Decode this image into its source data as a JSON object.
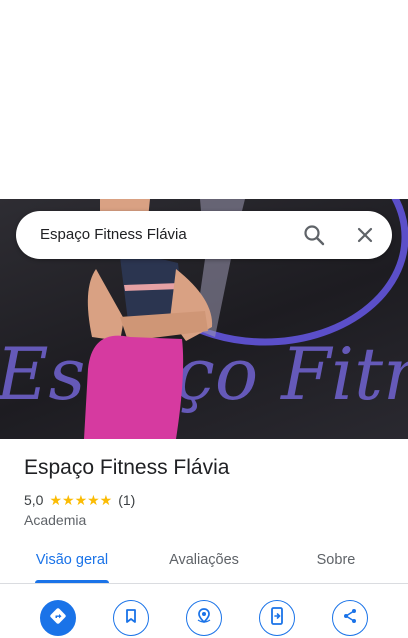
{
  "search": {
    "query": "Espaço Fitness Flávia"
  },
  "hero": {
    "wall_text": "Espaço Fitness"
  },
  "place": {
    "name": "Espaço Fitness Flávia",
    "rating": "5,0",
    "stars": "★★★★★",
    "review_count": "(1)",
    "category": "Academia"
  },
  "tabs": [
    {
      "label": "Visão geral",
      "active": true
    },
    {
      "label": "Avaliações",
      "active": false
    },
    {
      "label": "Sobre",
      "active": false
    }
  ],
  "actions": [
    {
      "icon": "directions-icon",
      "filled": true
    },
    {
      "icon": "bookmark-icon",
      "filled": false
    },
    {
      "icon": "nearby-icon",
      "filled": false
    },
    {
      "icon": "send-to-phone-icon",
      "filled": false
    },
    {
      "icon": "share-icon",
      "filled": false
    }
  ],
  "colors": {
    "accent": "#1a73e8",
    "star": "#fbbc04",
    "wall_ring": "#6a5acd"
  }
}
